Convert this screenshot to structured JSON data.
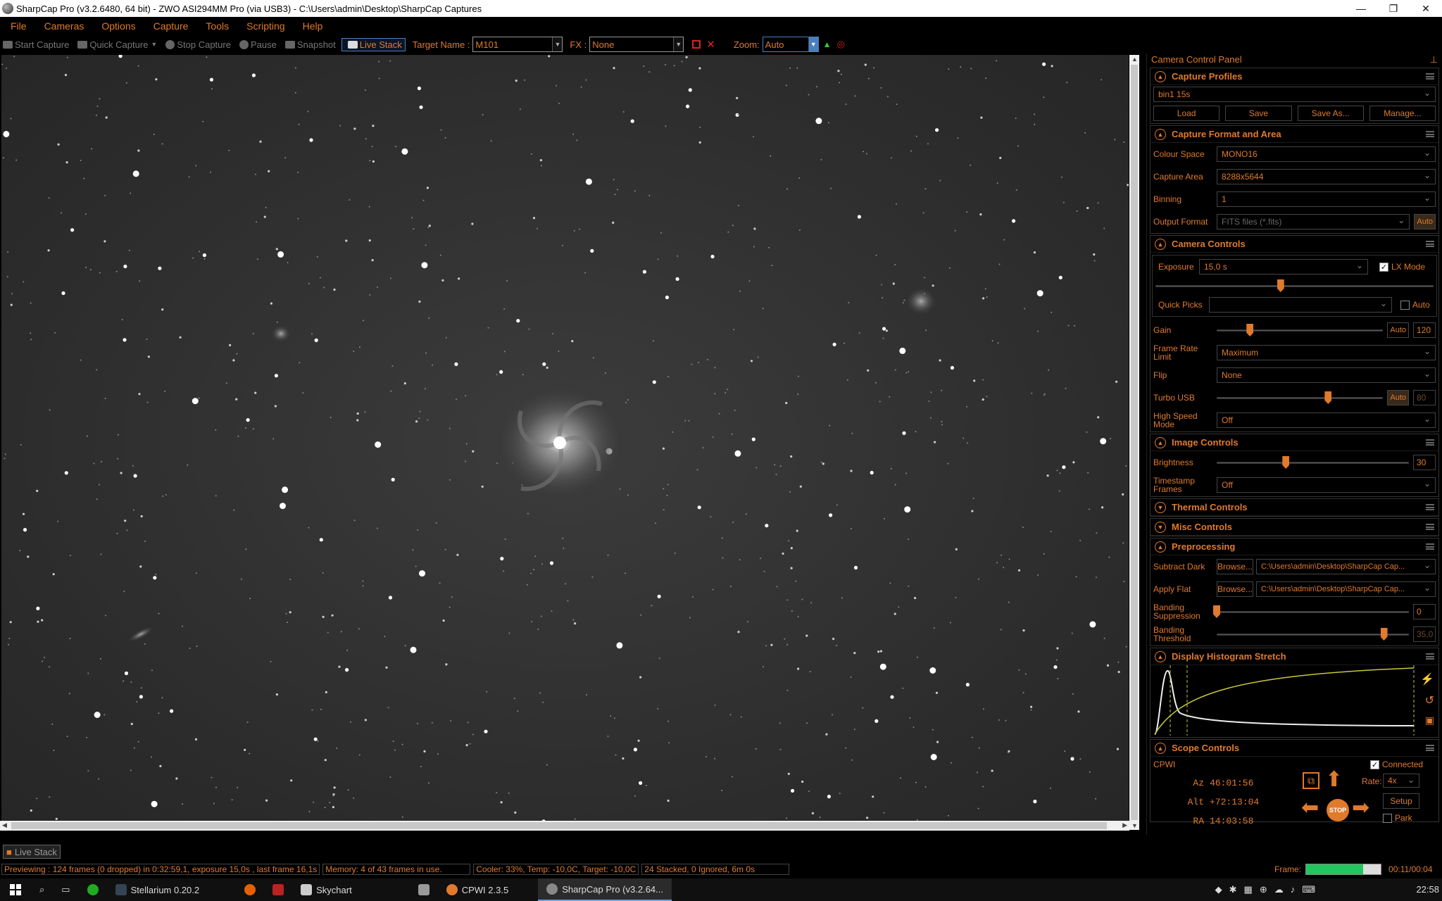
{
  "window": {
    "title": "SharpCap Pro (v3.2.6480, 64 bit) - ZWO ASI294MM Pro (via USB3) - C:\\Users\\admin\\Desktop\\SharpCap Captures",
    "controls": [
      "—",
      "❐",
      "✕"
    ]
  },
  "menu": [
    "File",
    "Cameras",
    "Options",
    "Capture",
    "Tools",
    "Scripting",
    "Help"
  ],
  "toolbar": {
    "start_capture": "Start Capture",
    "quick_capture": "Quick Capture",
    "stop_capture": "Stop Capture",
    "pause": "Pause",
    "snapshot": "Snapshot",
    "live_stack": "Live Stack",
    "target_name_label": "Target Name :",
    "target_name_value": "M101",
    "fx_label": "FX :",
    "fx_value": "None",
    "zoom_label": "Zoom:",
    "zoom_value": "Auto"
  },
  "panel": {
    "title": "Camera Control Panel",
    "capture_profiles": {
      "header": "Capture Profiles",
      "profile": "bin1 15s",
      "buttons": [
        "Load",
        "Save",
        "Save As...",
        "Manage..."
      ]
    },
    "capture_format": {
      "header": "Capture Format and Area",
      "colour_space_label": "Colour Space",
      "colour_space": "MONO16",
      "capture_area_label": "Capture Area",
      "capture_area": "8288x5644",
      "binning_label": "Binning",
      "binning": "1",
      "output_format_label": "Output Format",
      "output_format": "FITS files (*.fits)",
      "auto": "Auto"
    },
    "camera_controls": {
      "header": "Camera Controls",
      "exposure_label": "Exposure",
      "exposure": "15,0 s",
      "lx_mode": "LX Mode",
      "exposure_slider": 0.45,
      "quick_picks_label": "Quick Picks",
      "quick_picks_auto": "Auto",
      "gain_label": "Gain",
      "gain_auto": "Auto",
      "gain": "120",
      "gain_slider": 0.2,
      "frame_rate_label": "Frame Rate Limit",
      "frame_rate": "Maximum",
      "flip_label": "Flip",
      "flip": "None",
      "turbo_usb_label": "Turbo USB",
      "turbo_auto": "Auto",
      "turbo": "80",
      "turbo_slider": 0.67,
      "high_speed_label": "High Speed Mode",
      "high_speed": "Off"
    },
    "image_controls": {
      "header": "Image Controls",
      "brightness_label": "Brightness",
      "brightness": "30",
      "brightness_slider": 0.36,
      "timestamp_label": "Timestamp Frames",
      "timestamp": "Off"
    },
    "thermal_header": "Thermal Controls",
    "misc_header": "Misc Controls",
    "preprocessing": {
      "header": "Preprocessing",
      "subtract_dark_label": "Subtract Dark",
      "browse": "Browse...",
      "dark_path": "C:\\Users\\admin\\Desktop\\SharpCap Cap...",
      "apply_flat_label": "Apply Flat",
      "flat_path": "C:\\Users\\admin\\Desktop\\SharpCap Cap...",
      "banding_suppression_label": "Banding Suppression",
      "banding_suppression": "0",
      "banding_suppression_slider": 0.0,
      "banding_threshold_label": "Banding Threshold",
      "banding_threshold": "35,0",
      "banding_threshold_slider": 0.87
    },
    "histogram_header": "Display Histogram Stretch",
    "scope": {
      "header": "Scope Controls",
      "mount": "CPWI",
      "connected": "Connected",
      "az_label": "Az",
      "az": "46:01:56",
      "alt_label": "Alt",
      "alt": "+72:13:04",
      "ra_label": "RA",
      "ra": "14:03:58",
      "rate_label": "Rate:",
      "rate": "4x",
      "setup": "Setup",
      "park": "Park",
      "stop": "STOP"
    }
  },
  "status": {
    "live_stack_tab": "Live Stack",
    "previewing": "Previewing : 124 frames (0 dropped) in 0:32:59,1, exposure 15,0s , last frame 16,1s",
    "memory": "Memory: 4 of 43 frames in use.",
    "cooler": "Cooler: 33%, Temp: -10,0C, Target: -10,0C",
    "stacked": "24 Stacked, 0 Ignored, 6m 0s",
    "frame_label": "Frame:",
    "frame_progress": 0.76,
    "elapsed": "00:11/00:04"
  },
  "taskbar": {
    "items": [
      "Stellarium 0.20.2",
      "Skychart",
      "CPWI 2.3.5",
      "SharpCap Pro (v3.2.64..."
    ],
    "clock": "22:58"
  },
  "colors": {
    "accent": "#e07a2c",
    "background": "#000000",
    "live_stack_border": "#4a7fbf",
    "frame_bar": "#22c55e"
  }
}
